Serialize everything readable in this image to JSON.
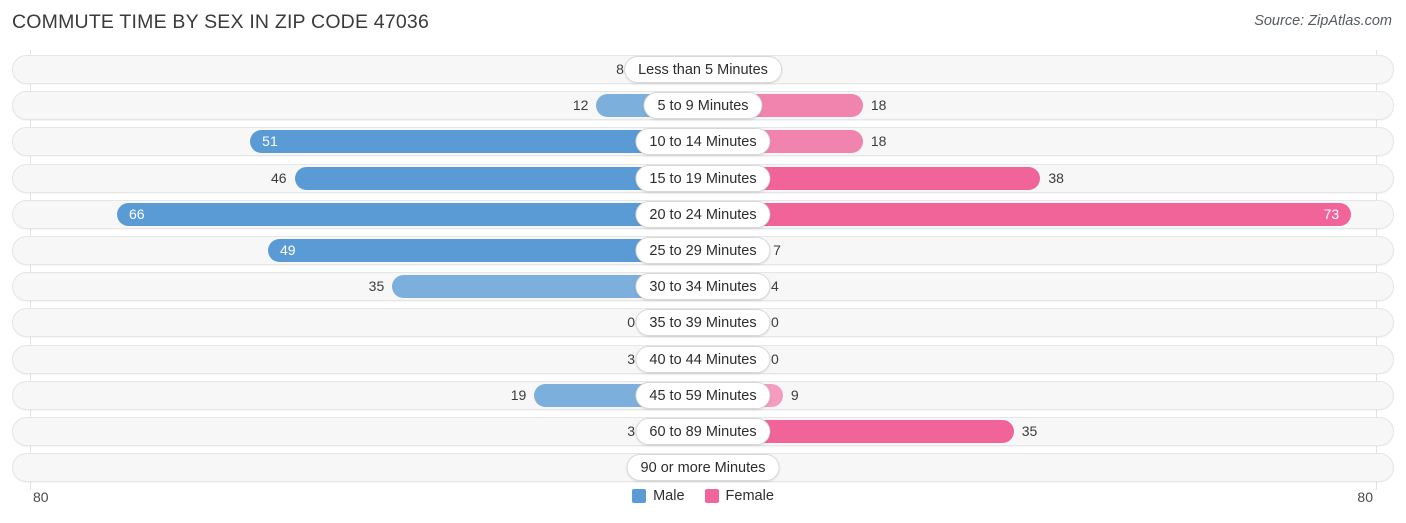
{
  "header": {
    "title": "COMMUTE TIME BY SEX IN ZIP CODE 47036",
    "source": "Source: ZipAtlas.com"
  },
  "axis": {
    "left_label": "80",
    "right_label": "80"
  },
  "legend": {
    "items": [
      {
        "label": "Male",
        "color": "#5b9bd5"
      },
      {
        "label": "Female",
        "color": "#f0649a"
      }
    ]
  },
  "chart_data": {
    "type": "bar",
    "title": "COMMUTE TIME BY SEX IN ZIP CODE 47036",
    "subtitle": "Source: ZipAtlas.com",
    "orientation": "horizontal-diverging",
    "xlabel": "",
    "ylabel": "",
    "xlim": [
      80,
      80
    ],
    "axis_max": 80,
    "grid": true,
    "legend_position": "bottom-center",
    "categories": [
      "Less than 5 Minutes",
      "5 to 9 Minutes",
      "10 to 14 Minutes",
      "15 to 19 Minutes",
      "20 to 24 Minutes",
      "25 to 29 Minutes",
      "30 to 34 Minutes",
      "35 to 39 Minutes",
      "40 to 44 Minutes",
      "45 to 59 Minutes",
      "60 to 89 Minutes",
      "90 or more Minutes"
    ],
    "series": [
      {
        "name": "Male",
        "color": "#5b9bd5",
        "side": "left",
        "values": [
          8,
          12,
          51,
          46,
          66,
          49,
          35,
          0,
          3,
          19,
          3,
          0
        ]
      },
      {
        "name": "Female",
        "color": "#f0649a",
        "side": "right",
        "values": [
          0,
          18,
          18,
          38,
          73,
          7,
          4,
          0,
          0,
          9,
          35,
          0
        ]
      }
    ]
  }
}
